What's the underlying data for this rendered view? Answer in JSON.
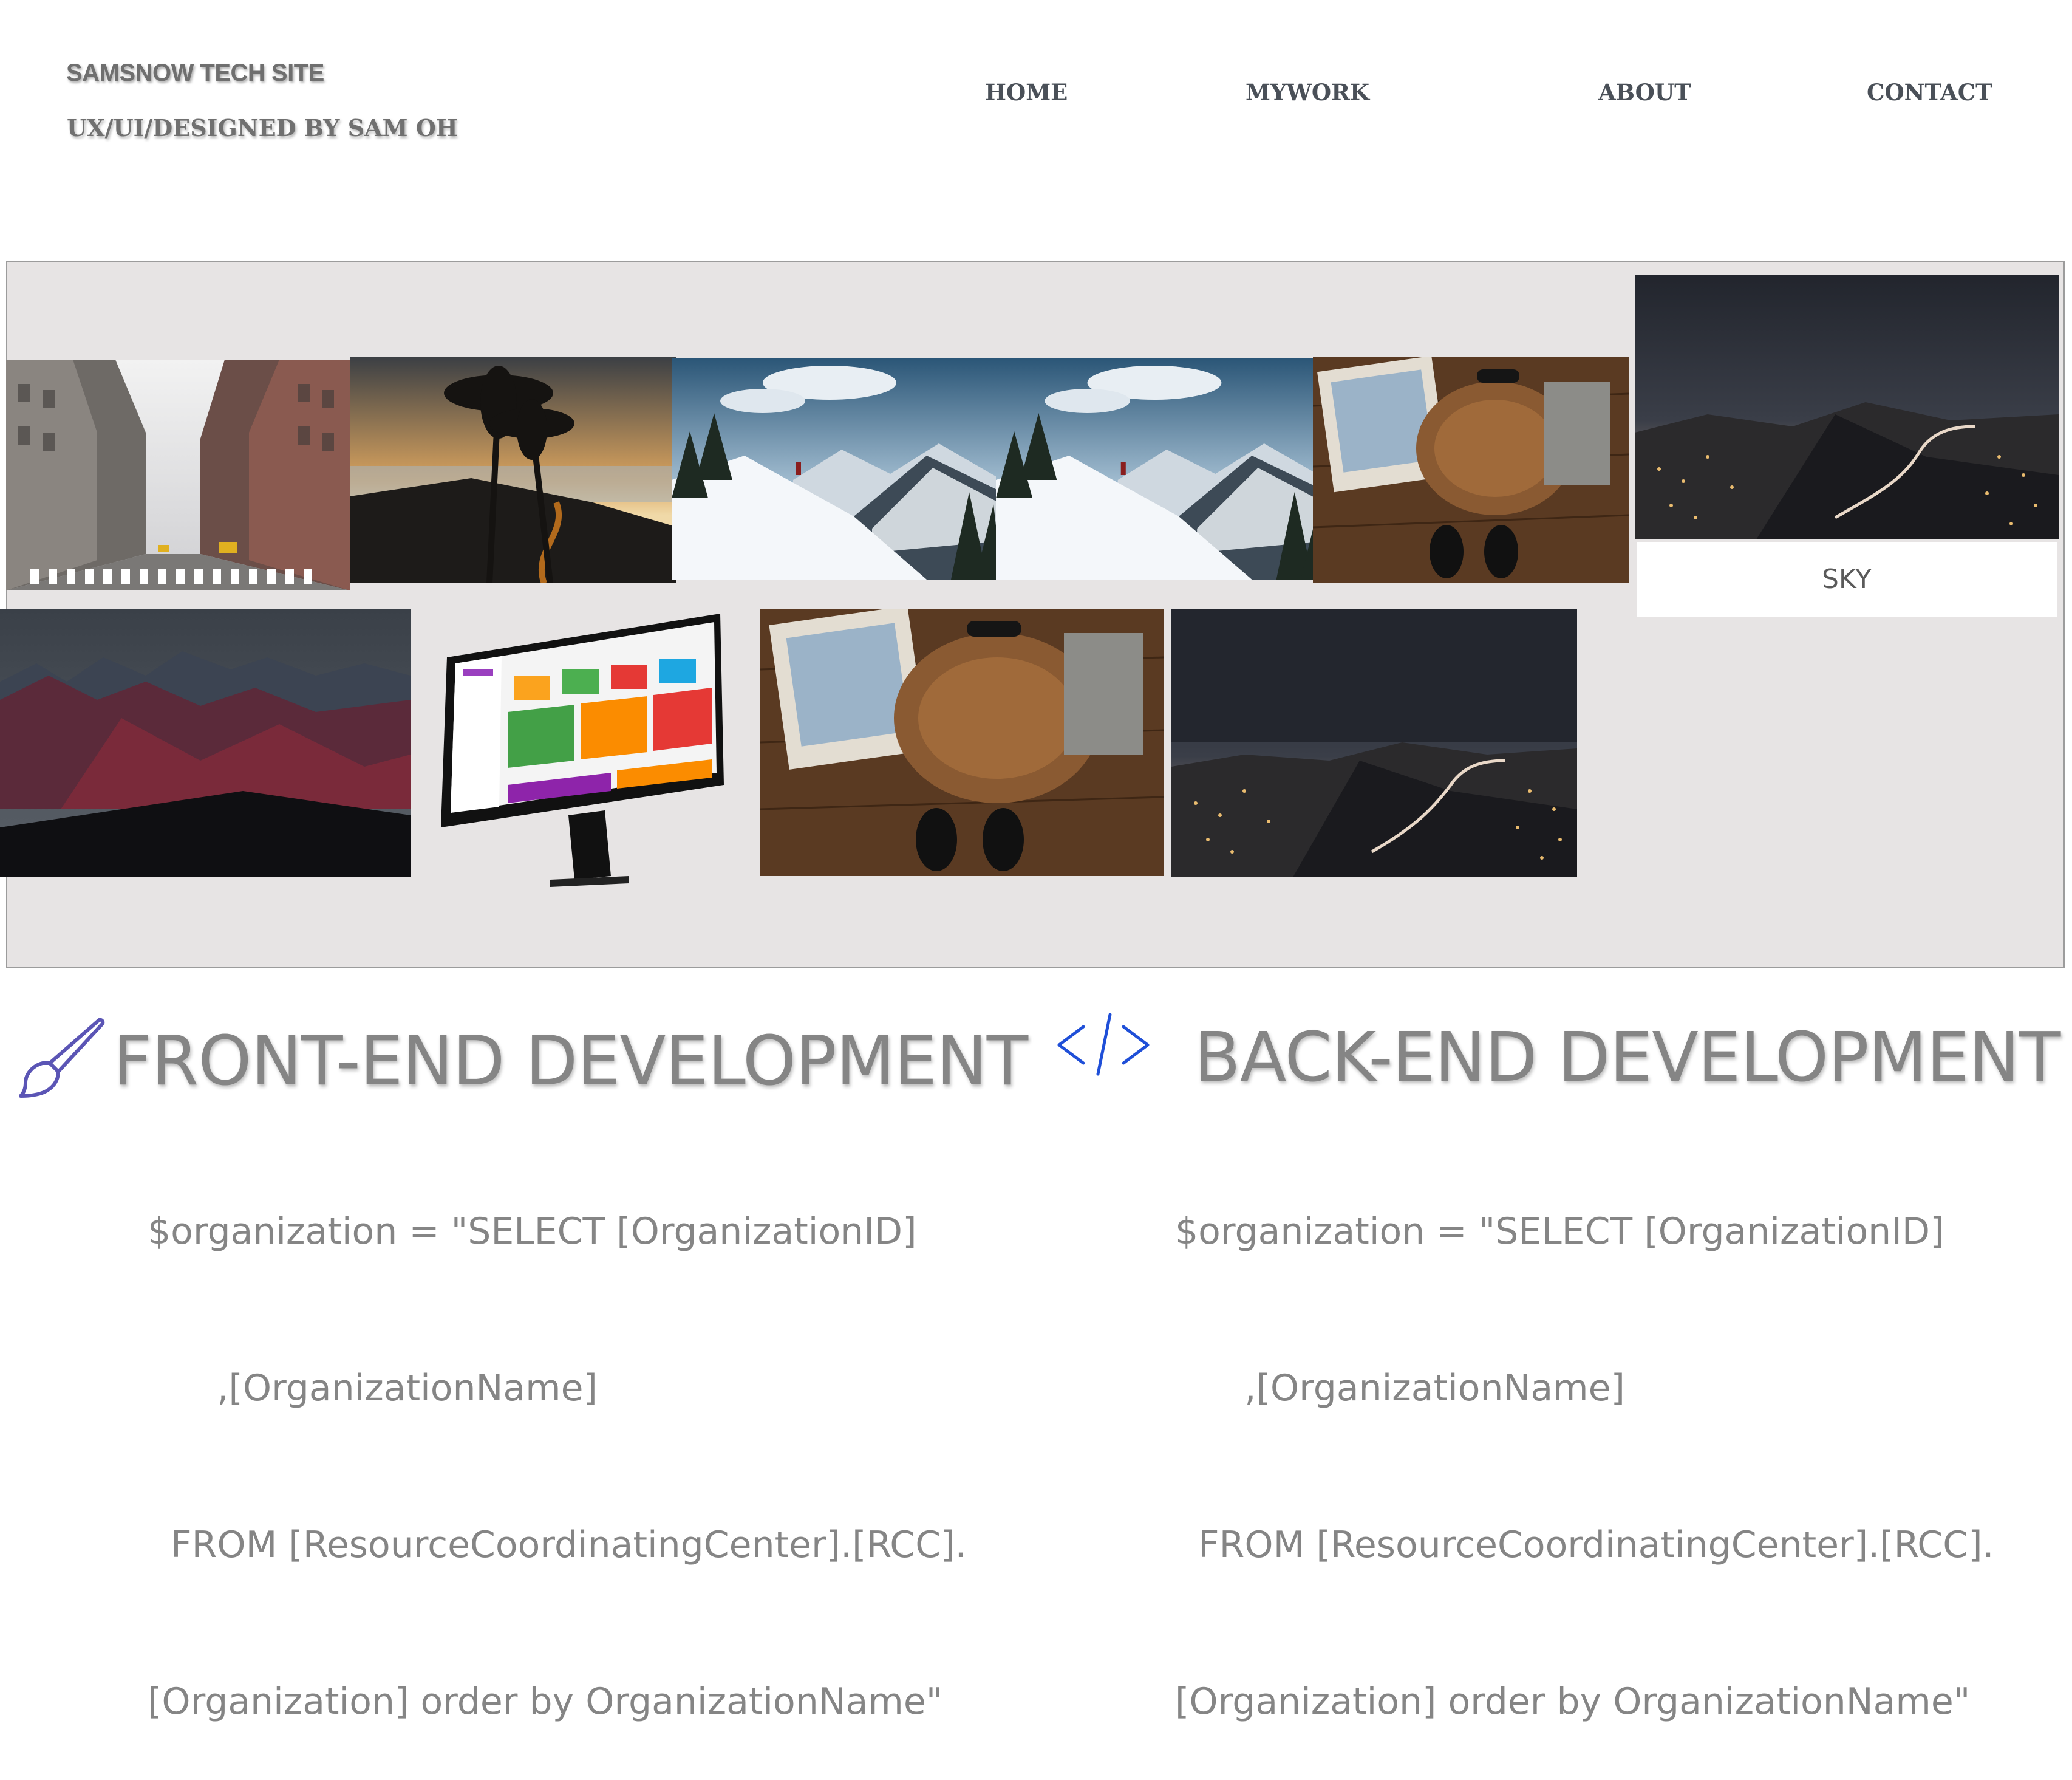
{
  "header": {
    "site_title": "SAMSNOW TECH SITE",
    "site_subtitle": "UX/UI/DESIGNED BY SAM OH",
    "nav": [
      {
        "label": "HOME"
      },
      {
        "label": "MYWORK"
      },
      {
        "label": "ABOUT"
      },
      {
        "label": "CONTACT"
      }
    ]
  },
  "gallery": {
    "background": "#e7e4e4",
    "items": [
      {
        "image": "city-street-photo"
      },
      {
        "image": "palm-trees-sunset-photo"
      },
      {
        "image": "snowy-mountain-hiker-photo"
      },
      {
        "image": "snowy-mountain-hiker-photo"
      },
      {
        "image": "travel-desk-flatlay-photo"
      },
      {
        "image": "night-city-sky-photo",
        "caption": "SKY"
      },
      {
        "image": "red-mountains-photo"
      },
      {
        "image": "imac-dashboard-photo"
      },
      {
        "image": "travel-desk-flatlay-photo"
      },
      {
        "image": "night-city-road-photo"
      }
    ]
  },
  "sections": {
    "front": {
      "icon": "paintbrush-icon",
      "icon_color": "#5b55b5",
      "heading": "FRONT-END DEVELOPMENT",
      "code_lines": [
        "$organization = \"SELECT [OrganizationID]",
        "      ,[OrganizationName]",
        "  FROM [ResourceCoordinatingCenter].[RCC].",
        "[Organization] order by OrganizationName\""
      ]
    },
    "back": {
      "icon": "code-brackets-icon",
      "icon_color": "#1f4fd8",
      "heading": "BACK-END DEVELOPMENT",
      "code_lines": [
        "$organization = \"SELECT [OrganizationID]",
        "      ,[OrganizationName]",
        "  FROM [ResourceCoordinatingCenter].[RCC].",
        "[Organization] order by OrganizationName\""
      ]
    }
  }
}
